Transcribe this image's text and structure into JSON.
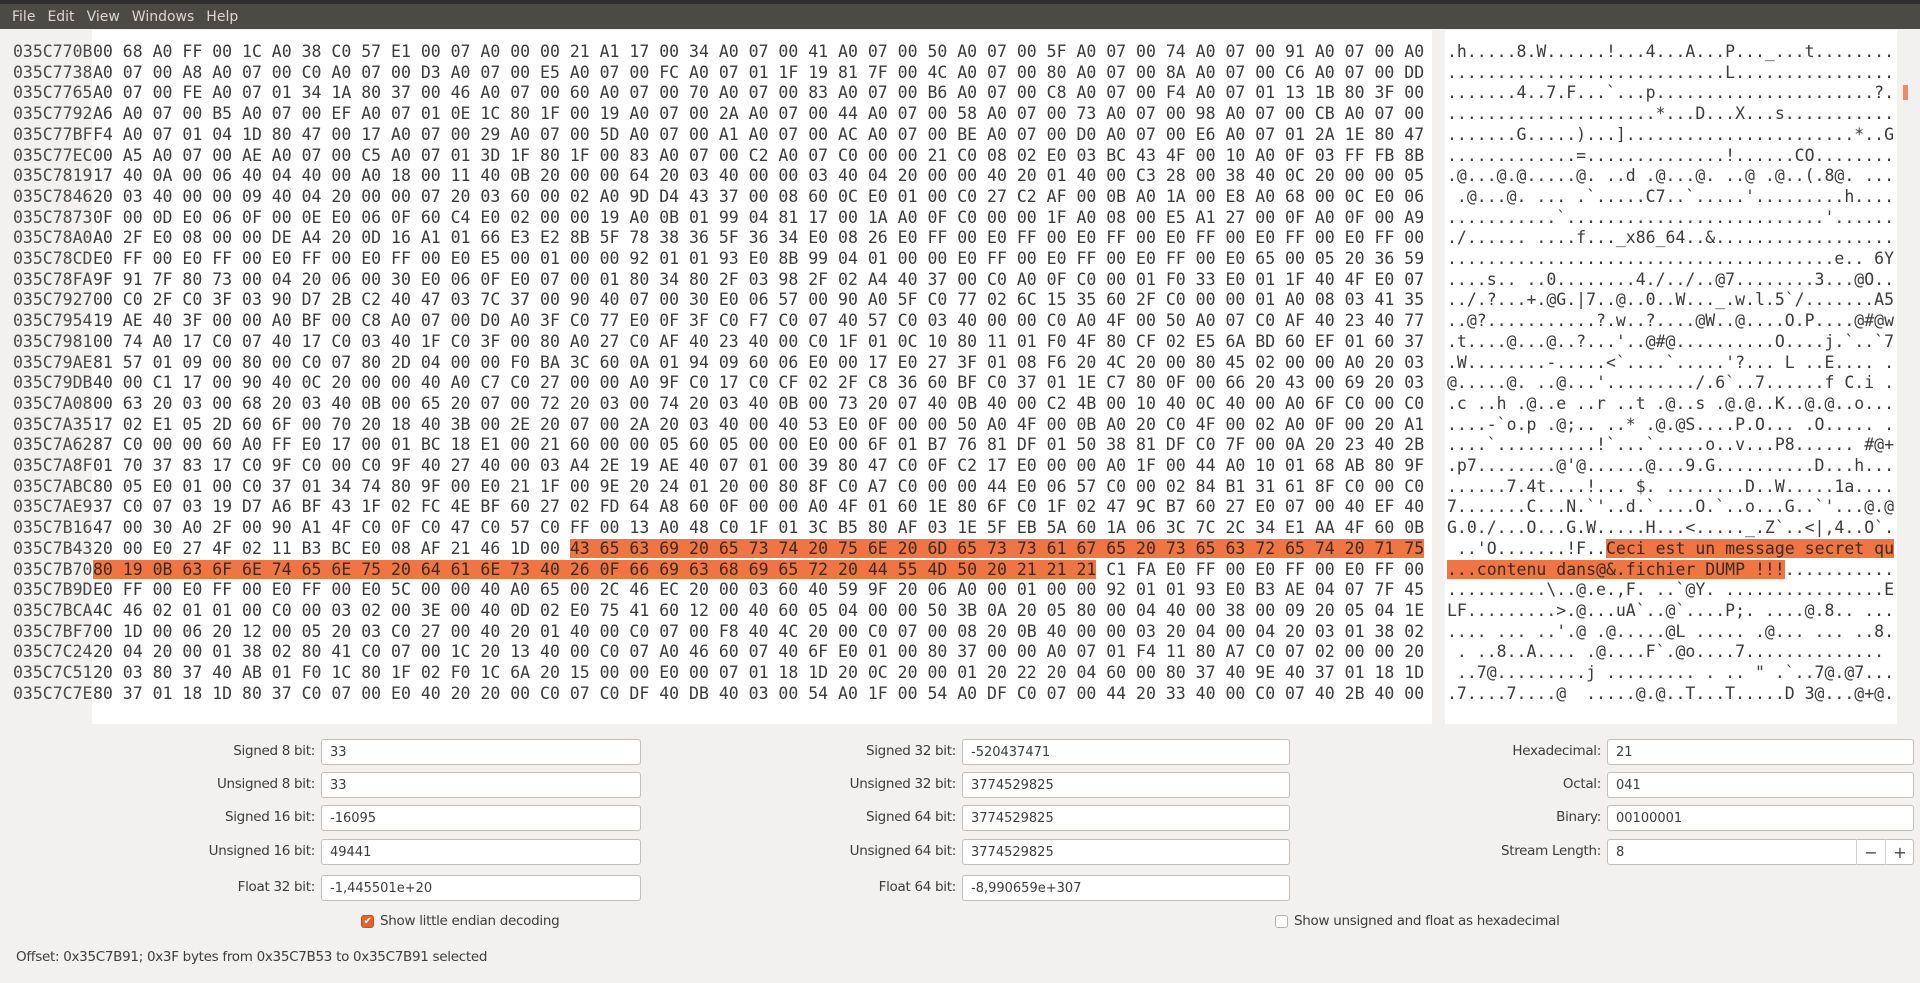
{
  "menu": [
    "File",
    "Edit",
    "View",
    "Windows",
    "Help"
  ],
  "colors": {
    "selection": "#ef7644",
    "menubar": "#4c4a44"
  },
  "selection": {
    "start": "035C7B53",
    "end": "035C7B91"
  },
  "rows": [
    {
      "offset": "035C770B",
      "bytes": "00 68 A0 FF 00 1C A0 38 C0 57 E1 00 07 A0 00 00 21 A1 17 00 34 A0 07 00 41 A0 07 00 50 A0 07 00 5F A0 07 00 74 A0 07 00 91 A0 07 00 A0"
    },
    {
      "offset": "035C7738",
      "bytes": "A0 07 00 A8 A0 07 00 C0 A0 07 00 D3 A0 07 00 E5 A0 07 00 FC A0 07 01 1F 19 81 7F 00 4C A0 07 00 80 A0 07 00 8A A0 07 00 C6 A0 07 00 DD"
    },
    {
      "offset": "035C7765",
      "bytes": "A0 07 00 FE A0 07 01 34 1A 80 37 00 46 A0 07 00 60 A0 07 00 70 A0 07 00 83 A0 07 00 B6 A0 07 00 C8 A0 07 00 F4 A0 07 01 13 1B 80 3F 00"
    },
    {
      "offset": "035C7792",
      "bytes": "A6 A0 07 00 B5 A0 07 00 EF A0 07 01 0E 1C 80 1F 00 19 A0 07 00 2A A0 07 00 44 A0 07 00 58 A0 07 00 73 A0 07 00 98 A0 07 00 CB A0 07 00"
    },
    {
      "offset": "035C77BF",
      "bytes": "F4 A0 07 01 04 1D 80 47 00 17 A0 07 00 29 A0 07 00 5D A0 07 00 A1 A0 07 00 AC A0 07 00 BE A0 07 00 D0 A0 07 00 E6 A0 07 01 2A 1E 80 47"
    },
    {
      "offset": "035C77EC",
      "bytes": "00 A5 A0 07 00 AE A0 07 00 C5 A0 07 01 3D 1F 80 1F 00 83 A0 07 00 C2 A0 07 C0 00 00 21 C0 08 02 E0 03 BC 43 4F 00 10 A0 0F 03 FF FB 8B"
    },
    {
      "offset": "035C7819",
      "bytes": "17 40 0A 00 06 40 04 40 00 A0 18 00 11 40 0B 20 00 00 64 20 03 40 00 00 03 40 04 20 00 00 40 20 01 40 00 C3 28 00 38 40 0C 20 00 00 05"
    },
    {
      "offset": "035C7846",
      "bytes": "20 03 40 00 00 09 40 04 20 00 00 07 20 03 60 00 02 A0 9D D4 43 37 00 08 60 0C E0 01 00 C0 27 C2 AF 00 0B A0 1A 00 E8 A0 68 00 0C E0 06"
    },
    {
      "offset": "035C7873",
      "bytes": "0F 00 0D E0 06 0F 00 0E E0 06 0F 60 C4 E0 02 00 00 19 A0 0B 01 99 04 81 17 00 1A A0 0F C0 00 00 1F A0 08 00 E5 A1 27 00 0F A0 0F 00 A9"
    },
    {
      "offset": "035C78A0",
      "bytes": "A0 2F E0 08 00 00 DE A4 20 0D 16 A1 01 66 E3 E2 8B 5F 78 38 36 5F 36 34 E0 08 26 E0 FF 00 E0 FF 00 E0 FF 00 E0 FF 00 E0 FF 00 E0 FF 00"
    },
    {
      "offset": "035C78CD",
      "bytes": "E0 FF 00 E0 FF 00 E0 FF 00 E0 FF 00 E0 E5 00 01 00 00 92 01 01 93 E0 8B 99 04 01 00 00 E0 FF 00 E0 FF 00 E0 FF 00 E0 65 00 05 20 36 59"
    },
    {
      "offset": "035C78FA",
      "bytes": "9F 91 7F 80 73 00 04 20 06 00 30 E0 06 0F E0 07 00 01 80 34 80 2F 03 98 2F 02 A4 40 37 00 C0 A0 0F C0 00 01 F0 33 E0 01 1F 40 4F E0 07"
    },
    {
      "offset": "035C7927",
      "bytes": "00 C0 2F C0 3F 03 90 D7 2B C2 40 47 03 7C 37 00 90 40 07 00 30 E0 06 57 00 90 A0 5F C0 77 02 6C 15 35 60 2F C0 00 00 01 A0 08 03 41 35"
    },
    {
      "offset": "035C7954",
      "bytes": "19 AE 40 3F 00 00 A0 BF 00 C8 A0 07 00 D0 A0 3F C0 77 E0 0F 3F C0 F7 C0 07 40 57 C0 03 40 00 00 C0 A0 4F 00 50 A0 07 C0 AF 40 23 40 77"
    },
    {
      "offset": "035C7981",
      "bytes": "00 74 A0 17 C0 07 40 17 C0 03 40 1F C0 3F 00 80 A0 27 C0 AF 40 23 40 00 C0 1F 01 0C 10 80 11 01 F0 4F 80 CF 02 E5 6A BD 60 EF 01 60 37"
    },
    {
      "offset": "035C79AE",
      "bytes": "81 57 01 09 00 80 00 C0 07 80 2D 04 00 00 F0 BA 3C 60 0A 01 94 09 60 06 E0 00 17 E0 27 3F 01 08 F6 20 4C 20 00 80 45 02 00 00 A0 20 03"
    },
    {
      "offset": "035C79DB",
      "bytes": "40 00 C1 17 00 90 40 0C 20 00 00 40 A0 C7 C0 27 00 00 A0 9F C0 17 C0 CF 02 2F C8 36 60 BF C0 37 01 1E C7 80 0F 00 66 20 43 00 69 20 03"
    },
    {
      "offset": "035C7A08",
      "bytes": "00 63 20 03 00 68 20 03 40 0B 00 65 20 07 00 72 20 03 00 74 20 03 40 0B 00 73 20 07 40 0B 40 00 C2 4B 00 10 40 0C 40 00 A0 6F C0 00 C0"
    },
    {
      "offset": "035C7A35",
      "bytes": "17 02 E1 05 2D 60 6F 00 70 20 18 40 3B 00 2E 20 07 00 2A 20 03 40 00 40 53 E0 0F 00 00 50 A0 4F 00 0B A0 20 C0 4F 00 02 A0 0F 00 20 A1"
    },
    {
      "offset": "035C7A62",
      "bytes": "87 C0 00 00 60 A0 FF E0 17 00 01 BC 18 E1 00 21 60 00 00 05 60 05 00 00 E0 00 6F 01 B7 76 81 DF 01 50 38 81 DF C0 7F 00 0A 20 23 40 2B"
    },
    {
      "offset": "035C7A8F",
      "bytes": "01 70 37 83 17 C0 9F C0 00 C0 9F 40 27 40 00 03 A4 2E 19 AE 40 07 01 00 39 80 47 C0 0F C2 17 E0 00 00 A0 1F 00 44 A0 10 01 68 AB 80 9F"
    },
    {
      "offset": "035C7ABC",
      "bytes": "80 05 E0 01 00 C0 37 01 34 74 80 9F 00 E0 21 1F 00 9E 20 24 01 20 00 80 8F C0 A7 C0 00 00 44 E0 06 57 C0 00 02 84 B1 31 61 8F C0 00 C0"
    },
    {
      "offset": "035C7AE9",
      "bytes": "37 C0 07 03 19 D7 A6 BF 43 1F 02 FC 4E BF 60 27 02 FD 64 A8 60 0F 00 00 A0 4F 01 60 1E 80 6F C0 1F 02 47 9C B7 60 27 E0 07 00 40 EF 40"
    },
    {
      "offset": "035C7B16",
      "bytes": "47 00 30 A0 2F 00 90 A1 4F C0 0F C0 47 C0 57 C0 FF 00 13 A0 48 C0 1F 01 3C B5 80 AF 03 1E 5F EB 5A 60 1A 06 3C 7C 2C 34 E1 AA 4F 60 0B"
    },
    {
      "offset": "035C7B43",
      "bytes": "20 00 E0 27 4F 02 11 B3 BC E0 08 AF 21 46 1D 00 43 65 63 69 20 65 73 74 20 75 6E 20 6D 65 73 73 61 67 65 20 73 65 63 72 65 74 20 71 75"
    },
    {
      "offset": "035C7B70",
      "bytes": "80 19 0B 63 6F 6E 74 65 6E 75 20 64 61 6E 73 40 26 0F 66 69 63 68 69 65 72 20 44 55 4D 50 20 21 21 21 C1 FA E0 FF 00 E0 FF 00 E0 FF 00"
    },
    {
      "offset": "035C7B9D",
      "bytes": "E0 FF 00 E0 FF 00 E0 FF 00 E0 5C 00 00 40 A0 65 00 2C 46 EC 20 00 03 60 40 59 9F 20 06 A0 00 01 00 00 92 01 01 93 E0 B3 AE 04 07 7F 45"
    },
    {
      "offset": "035C7BCA",
      "bytes": "4C 46 02 01 01 00 C0 00 03 02 00 3E 00 40 0D 02 E0 75 41 60 12 00 40 60 05 04 00 00 50 3B 0A 20 05 80 00 04 40 00 38 00 09 20 05 04 1E"
    },
    {
      "offset": "035C7BF7",
      "bytes": "00 1D 00 06 20 12 00 05 20 03 C0 27 00 40 20 01 40 00 C0 07 00 F8 40 4C 20 00 C0 07 00 08 20 0B 40 00 00 03 20 04 00 04 20 03 01 38 02"
    },
    {
      "offset": "035C7C24",
      "bytes": "20 04 20 00 01 38 02 80 41 C0 07 00 1C 20 13 40 00 C0 07 A0 46 60 07 40 6F E0 01 00 80 37 00 00 A0 07 01 F4 11 80 A7 C0 07 02 00 00 20"
    },
    {
      "offset": "035C7C51",
      "bytes": "20 03 80 37 40 AB 01 F0 1C 80 1F 02 F0 1C 6A 20 15 00 00 E0 00 07 01 18 1D 20 0C 20 00 01 20 22 20 04 60 00 80 37 40 9E 40 37 01 18 1D"
    },
    {
      "offset": "035C7C7E",
      "bytes": "80 37 01 18 1D 80 37 C0 07 00 E0 40 20 20 00 C0 07 C0 DF 40 DB 40 03 00 54 A0 1F 00 54 A0 DF C0 07 00 44 20 33 40 00 C0 07 40 2B 40 00"
    }
  ],
  "decoder": {
    "signed8": {
      "label": "Signed 8 bit:",
      "value": "33"
    },
    "unsigned8": {
      "label": "Unsigned 8 bit:",
      "value": "33"
    },
    "signed16": {
      "label": "Signed 16 bit:",
      "value": "-16095"
    },
    "unsigned16": {
      "label": "Unsigned 16 bit:",
      "value": "49441"
    },
    "float32": {
      "label": "Float 32 bit:",
      "value": "-1,445501e+20"
    },
    "signed32": {
      "label": "Signed 32 bit:",
      "value": "-520437471"
    },
    "unsigned32": {
      "label": "Unsigned 32 bit:",
      "value": "3774529825"
    },
    "signed64": {
      "label": "Signed 64 bit:",
      "value": "3774529825"
    },
    "unsigned64": {
      "label": "Unsigned 64 bit:",
      "value": "3774529825"
    },
    "float64": {
      "label": "Float 64 bit:",
      "value": "-8,990659e+307"
    },
    "hexadecimal": {
      "label": "Hexadecimal:",
      "value": "21"
    },
    "octal": {
      "label": "Octal:",
      "value": "041"
    },
    "binary": {
      "label": "Binary:",
      "value": "00100001"
    },
    "stream_length": {
      "label": "Stream Length:",
      "value": "8",
      "minus": "−",
      "plus": "+"
    },
    "little_endian": {
      "label": "Show little endian decoding",
      "checked": true
    },
    "unsigned_hex": {
      "label": "Show unsigned and float as hexadecimal",
      "checked": false
    }
  },
  "status": "Offset: 0x35C7B91; 0x3F bytes from 0x35C7B53 to 0x35C7B91 selected"
}
